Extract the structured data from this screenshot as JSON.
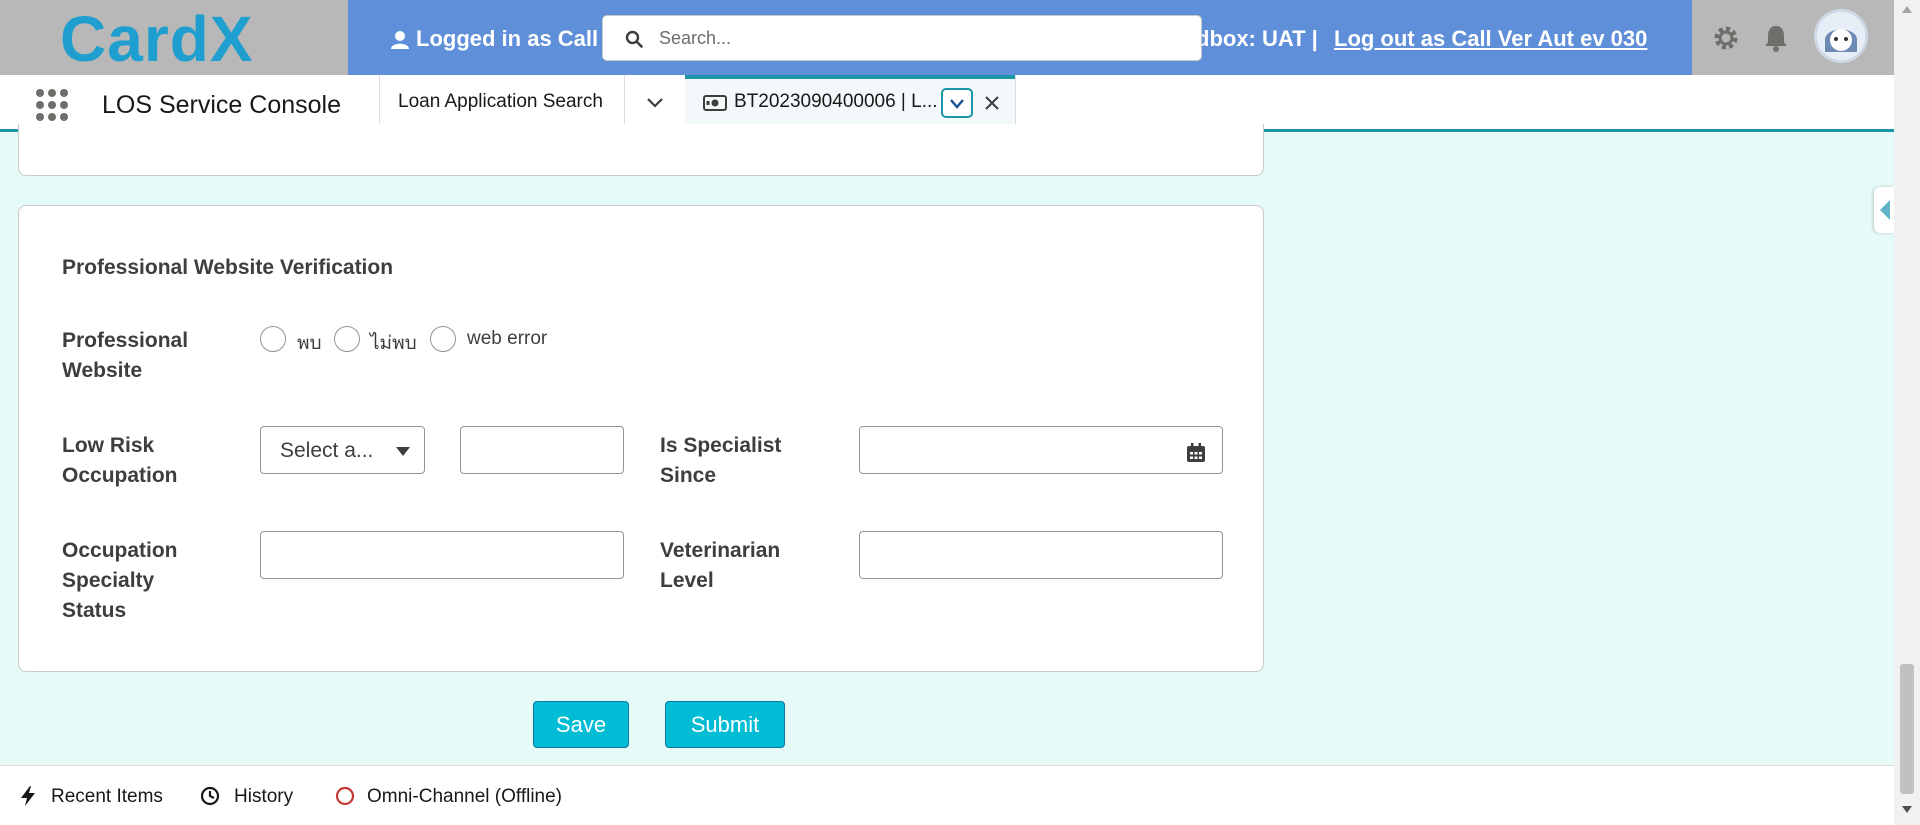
{
  "header": {
    "logo_text": "CardX",
    "logged_in_text": "Logged in as Call",
    "sandbox_text": "dbox: UAT |",
    "logout_text": "Log out as Call Ver Aut ev 030",
    "search_placeholder": "Search..."
  },
  "nav": {
    "app_name": "LOS Service Console",
    "tab_search_label": "Loan Application Search",
    "active_tab_label": "BT2023090400006 | L..."
  },
  "form": {
    "section_title": "Professional Website Verification",
    "professional_website_label": "Professional Website",
    "radio_options": [
      "พบ",
      "ไม่พบ",
      "web error"
    ],
    "low_risk_label": "Low Risk Occupation",
    "low_risk_select_value": "Select a...",
    "low_risk_text_value": "",
    "specialist_since_label": "Is Specialist Since",
    "specialist_since_value": "",
    "occupation_specialty_label": "Occupation Specialty Status",
    "occupation_specialty_value": "",
    "veterinarian_level_label": "Veterinarian Level",
    "veterinarian_level_value": ""
  },
  "actions": {
    "save_label": "Save",
    "submit_label": "Submit"
  },
  "utility_bar": {
    "recent_items": "Recent Items",
    "history": "History",
    "omni_channel": "Omni-Channel (Offline)"
  },
  "colors": {
    "accent": "#00bcd4",
    "banner": "#5f8fd9",
    "page_bg": "#e6faf8",
    "tab_border": "#1b96a8",
    "offline_status": "#c23934"
  },
  "icons": [
    "user-icon",
    "search-icon",
    "setup-icon",
    "bell-icon",
    "app-launcher-icon",
    "chevron-down-icon",
    "money-icon",
    "close-icon",
    "calendar-icon",
    "bolt-icon",
    "clock-icon",
    "offline-circle-icon"
  ]
}
